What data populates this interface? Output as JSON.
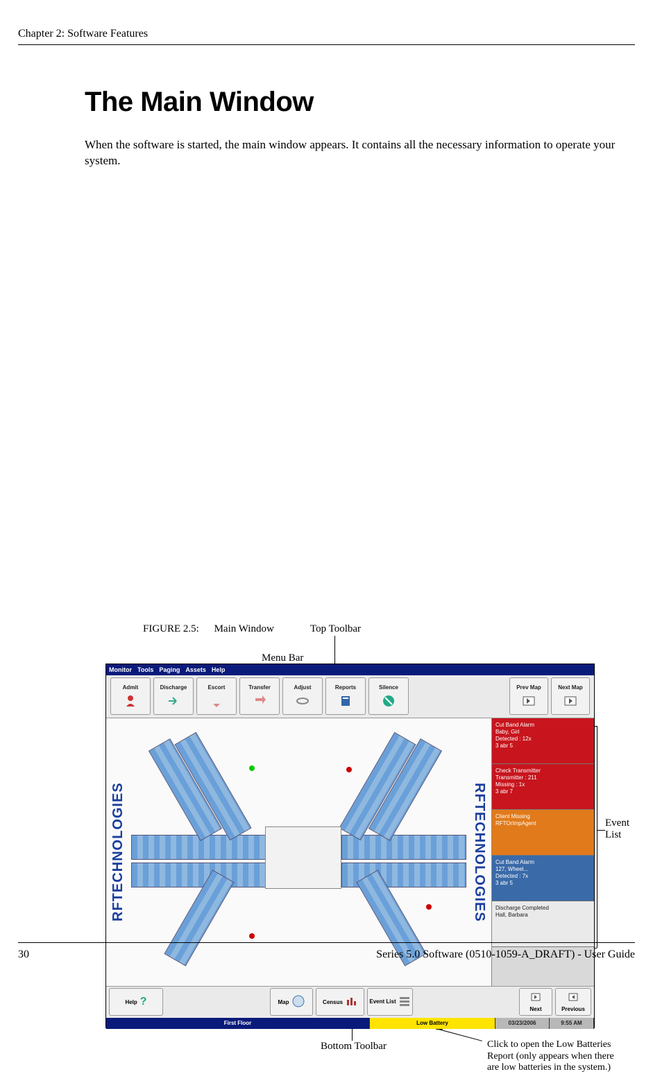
{
  "header": {
    "chapter": "Chapter 2: Software Features"
  },
  "heading": "The Main Window",
  "intro": "When the software is started, the main window appears. It contains all the necessary information to operate your system.",
  "callouts": {
    "top_toolbar": "Top Toolbar",
    "menu_bar": "Menu Bar",
    "event_list": "Event List",
    "bottom_toolbar": "Bottom Toolbar",
    "low_battery": "Click to open the Low Batteries Report (only appears when there are low batteries in the system.)"
  },
  "screenshot": {
    "menubar": [
      "Monitor",
      "Tools",
      "Paging",
      "Assets",
      "Help"
    ],
    "top_buttons": [
      {
        "label": "Admit",
        "icon": "admit-icon",
        "color": "#c33"
      },
      {
        "label": "Discharge",
        "icon": "discharge-icon",
        "color": "#3a7"
      },
      {
        "label": "Escort",
        "icon": "escort-icon",
        "color": "#d88"
      },
      {
        "label": "Transfer",
        "icon": "transfer-icon",
        "color": "#d88"
      },
      {
        "label": "Adjust",
        "icon": "adjust-icon",
        "color": "#888"
      },
      {
        "label": "Reports",
        "icon": "reports-icon",
        "color": "#36a"
      },
      {
        "label": "Silence",
        "icon": "silence-icon",
        "color": "#2a8"
      }
    ],
    "map_nav": [
      {
        "label": "Prev Map",
        "icon": "prev-map-icon"
      },
      {
        "label": "Next Map",
        "icon": "next-map-icon"
      }
    ],
    "brand": "RFTECHNOLOGIES",
    "events": [
      {
        "class": "ev-red",
        "lines": [
          "Cut Band Alarm",
          "Baby, Girl",
          "Detected : 12x",
          "3 abr 5"
        ]
      },
      {
        "class": "ev-red",
        "lines": [
          "Check Transmitter",
          "Transmitter : 211",
          "Missing : 1x",
          "3 abr 7"
        ]
      },
      {
        "class": "ev-orange",
        "lines": [
          "Client Missing",
          "RFTOrImpAgent"
        ]
      },
      {
        "class": "ev-blue",
        "lines": [
          "Cut Band Alarm",
          "127, Wheel...",
          "Detected : 7x",
          "3 abr 5"
        ]
      },
      {
        "class": "ev-white",
        "lines": [
          "Discharge Completed",
          "Hall, Barbara"
        ]
      }
    ],
    "bottom_buttons": {
      "help": "Help",
      "map": "Map",
      "census": "Census",
      "event_list": "Event List",
      "next": "Next",
      "previous": "Previous"
    },
    "status": {
      "floor": "First Floor",
      "low_battery": "Low Battery",
      "date": "03/23/2006",
      "time": "9:55 AM"
    }
  },
  "figure": {
    "number": "FIGURE 2.5:",
    "title": "Main Window"
  },
  "footer": {
    "page": "30",
    "doc": "Series 5.0 Software (0510-1059-A_DRAFT) - User Guide"
  }
}
